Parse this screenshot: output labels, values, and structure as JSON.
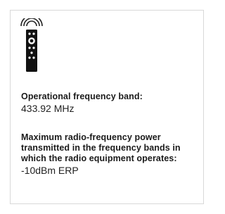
{
  "spec": {
    "icon": "remote-control-icon",
    "frequency": {
      "label": "Operational frequency band:",
      "value": "433.92 MHz"
    },
    "power": {
      "label": "Maximum radio-frequency power transmitted in the frequency bands in which the radio equipment operates:",
      "value": "-10dBm ERP"
    }
  }
}
